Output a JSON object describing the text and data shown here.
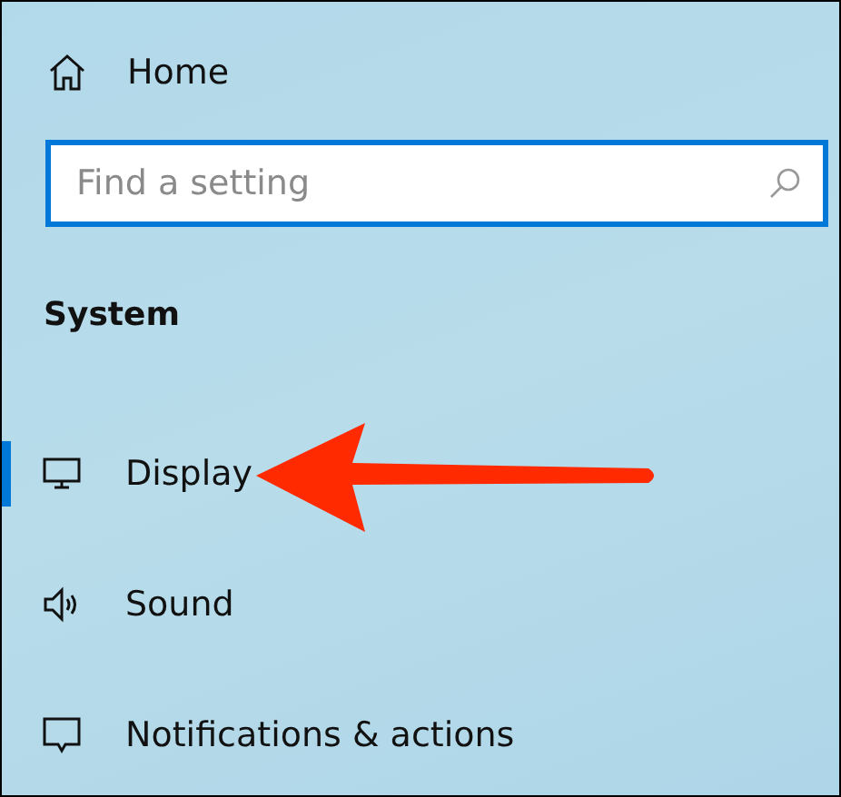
{
  "home": {
    "label": "Home"
  },
  "search": {
    "placeholder": "Find a setting",
    "focused": true
  },
  "section": {
    "title": "System"
  },
  "nav_items": [
    {
      "kind": "display",
      "label": "Display",
      "selected": true
    },
    {
      "kind": "sound",
      "label": "Sound",
      "selected": false
    },
    {
      "kind": "notifications",
      "label": "Notifications & actions",
      "selected": false
    }
  ]
}
